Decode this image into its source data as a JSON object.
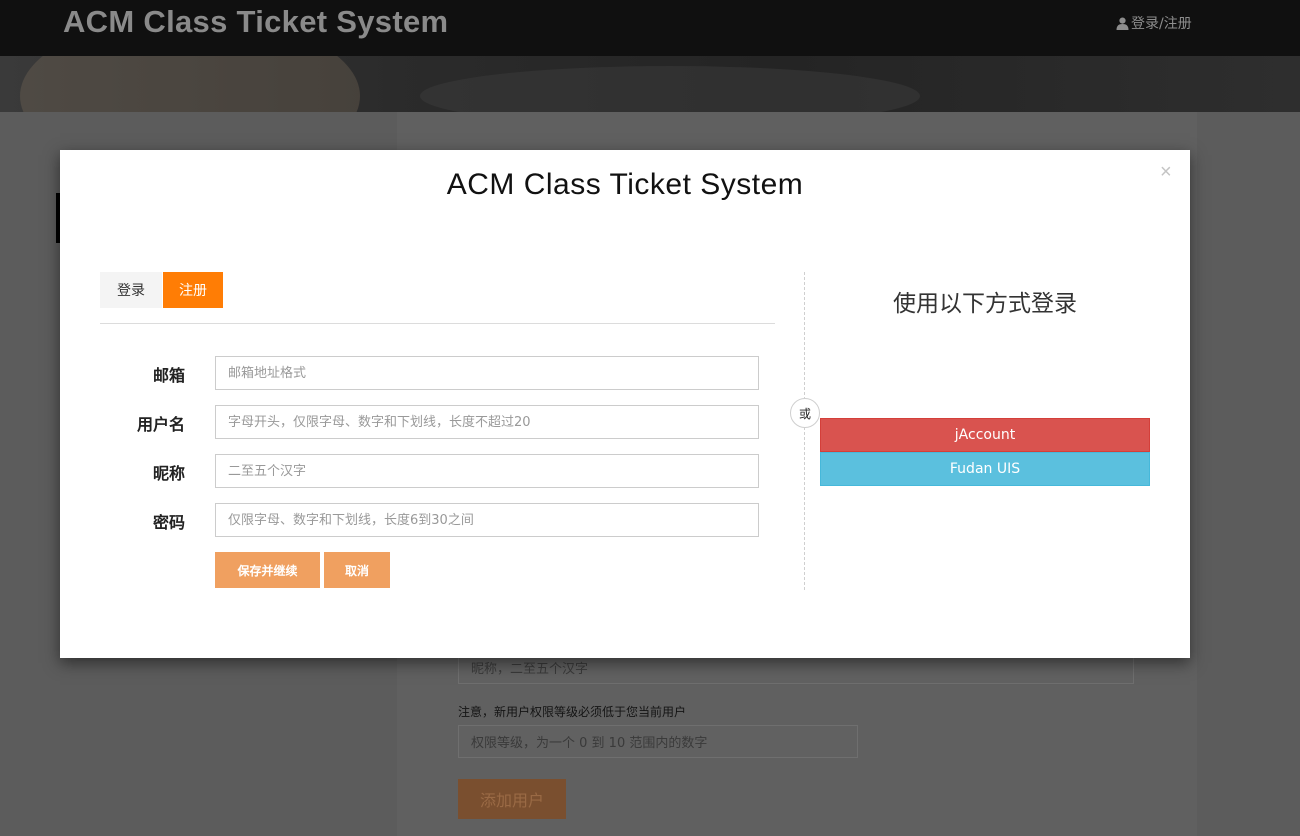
{
  "app": {
    "brand": "ACM Class Ticket System",
    "nav_login": "登录/注册"
  },
  "background": {
    "nickname_placeholder": "昵称，二至五个汉字",
    "note": "注意，新用户权限等级必须低于您当前用户",
    "level_placeholder": "权限等级，为一个 0 到 10 范围内的数字",
    "add_user_label": "添加用户"
  },
  "modal": {
    "title": "ACM Class Ticket System",
    "close_label": "×",
    "tabs": [
      {
        "label": "登录",
        "active": false
      },
      {
        "label": "注册",
        "active": true
      }
    ],
    "fields": [
      {
        "label": "邮箱",
        "placeholder": "邮箱地址格式",
        "value": ""
      },
      {
        "label": "用户名",
        "placeholder": "字母开头，仅限字母、数字和下划线，长度不超过20",
        "value": ""
      },
      {
        "label": "昵称",
        "placeholder": "二至五个汉字",
        "value": ""
      },
      {
        "label": "密码",
        "placeholder": "仅限字母、数字和下划线，长度6到30之间",
        "value": ""
      }
    ],
    "save_label": "保存并继续",
    "cancel_label": "取消",
    "or_label": "或",
    "alt_title": "使用以下方式登录",
    "sso": [
      {
        "label": "jAccount",
        "color": "#d9534f"
      },
      {
        "label": "Fudan UIS",
        "color": "#5bc0de"
      }
    ]
  },
  "colors": {
    "accent": "#ff7d05",
    "button_muted": "#f0a060"
  },
  "icons": {
    "nav_user": "user-icon"
  }
}
